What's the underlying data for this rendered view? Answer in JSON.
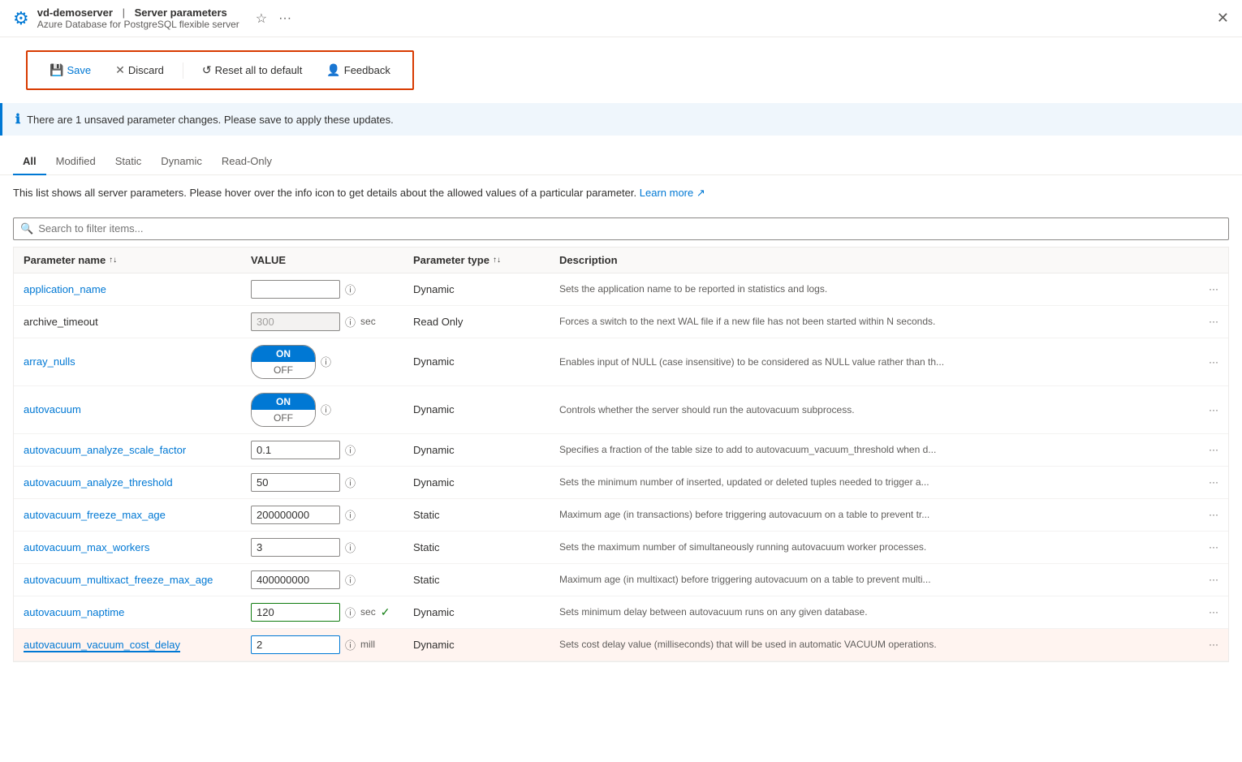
{
  "header": {
    "icon": "⚙",
    "server_name": "vd-demoserver",
    "separator": "|",
    "page_title": "Server parameters",
    "subtitle": "Azure Database for PostgreSQL flexible server",
    "star": "☆",
    "more": "···",
    "close": "✕"
  },
  "toolbar": {
    "save_label": "Save",
    "discard_label": "Discard",
    "reset_label": "Reset all to default",
    "feedback_label": "Feedback"
  },
  "info_bar": {
    "message": "There are 1 unsaved parameter changes.  Please save to apply these updates."
  },
  "tabs": [
    {
      "id": "all",
      "label": "All",
      "active": true
    },
    {
      "id": "modified",
      "label": "Modified",
      "active": false
    },
    {
      "id": "static",
      "label": "Static",
      "active": false
    },
    {
      "id": "dynamic",
      "label": "Dynamic",
      "active": false
    },
    {
      "id": "readonly",
      "label": "Read-Only",
      "active": false
    }
  ],
  "description": "This list shows all server parameters. Please hover over the info icon to get details about the allowed values of a particular parameter.",
  "learn_more": "Learn more",
  "search_placeholder": "Search to filter items...",
  "table": {
    "columns": [
      {
        "label": "Parameter name",
        "sortable": true
      },
      {
        "label": "VALUE",
        "sortable": false
      },
      {
        "label": "Parameter type",
        "sortable": true
      },
      {
        "label": "Description",
        "sortable": false
      }
    ],
    "rows": [
      {
        "name": "application_name",
        "name_linked": true,
        "value_type": "text",
        "value": "",
        "placeholder": "",
        "unit": "",
        "disabled": false,
        "type": "Dynamic",
        "description": "Sets the application name to be reported in statistics and logs.",
        "highlighted": false,
        "modified": false
      },
      {
        "name": "archive_timeout",
        "name_linked": false,
        "value_type": "text",
        "value": "300",
        "placeholder": "300",
        "unit": "sec",
        "disabled": true,
        "type": "Read Only",
        "description": "Forces a switch to the next WAL file if a new file has not been started within N seconds.",
        "highlighted": false,
        "modified": false
      },
      {
        "name": "array_nulls",
        "name_linked": true,
        "value_type": "toggle",
        "value": "ON",
        "unit": "",
        "disabled": false,
        "type": "Dynamic",
        "description": "Enables input of NULL (case insensitive) to be considered as NULL value rather than th...",
        "highlighted": false,
        "modified": false
      },
      {
        "name": "autovacuum",
        "name_linked": true,
        "value_type": "toggle",
        "value": "ON",
        "unit": "",
        "disabled": false,
        "type": "Dynamic",
        "description": "Controls whether the server should run the autovacuum subprocess.",
        "highlighted": false,
        "modified": false
      },
      {
        "name": "autovacuum_analyze_scale_factor",
        "name_linked": true,
        "value_type": "text",
        "value": "0.1",
        "placeholder": "0.1",
        "unit": "",
        "disabled": false,
        "type": "Dynamic",
        "description": "Specifies a fraction of the table size to add to autovacuum_vacuum_threshold when d...",
        "highlighted": false,
        "modified": false
      },
      {
        "name": "autovacuum_analyze_threshold",
        "name_linked": true,
        "value_type": "text",
        "value": "50",
        "placeholder": "50",
        "unit": "",
        "disabled": false,
        "type": "Dynamic",
        "description": "Sets the minimum number of inserted, updated or deleted tuples needed to trigger a...",
        "highlighted": false,
        "modified": false
      },
      {
        "name": "autovacuum_freeze_max_age",
        "name_linked": true,
        "value_type": "text",
        "value": "200000000",
        "placeholder": "200000000",
        "unit": "",
        "disabled": false,
        "type": "Static",
        "description": "Maximum age (in transactions) before triggering autovacuum on a table to prevent tr...",
        "highlighted": false,
        "modified": false
      },
      {
        "name": "autovacuum_max_workers",
        "name_linked": true,
        "value_type": "text",
        "value": "3",
        "placeholder": "3",
        "unit": "",
        "disabled": false,
        "type": "Static",
        "description": "Sets the maximum number of simultaneously running autovacuum worker processes.",
        "highlighted": false,
        "modified": false
      },
      {
        "name": "autovacuum_multixact_freeze_max_age",
        "name_linked": true,
        "value_type": "text",
        "value": "400000000",
        "placeholder": "400000000",
        "unit": "",
        "disabled": false,
        "type": "Static",
        "description": "Maximum age (in multixact) before triggering autovacuum on a table to prevent multi...",
        "highlighted": false,
        "modified": false
      },
      {
        "name": "autovacuum_naptime",
        "name_linked": true,
        "value_type": "text",
        "value": "120",
        "placeholder": "120",
        "unit": "sec",
        "disabled": false,
        "type": "Dynamic",
        "description": "Sets minimum delay between autovacuum runs on any given database.",
        "highlighted": false,
        "modified": true
      },
      {
        "name": "autovacuum_vacuum_cost_delay",
        "name_linked": true,
        "value_type": "text",
        "value": "2",
        "placeholder": "2",
        "unit": "mill",
        "disabled": false,
        "type": "Dynamic",
        "description": "Sets cost delay value (milliseconds) that will be used in automatic VACUUM operations.",
        "highlighted": true,
        "modified": false
      }
    ]
  }
}
